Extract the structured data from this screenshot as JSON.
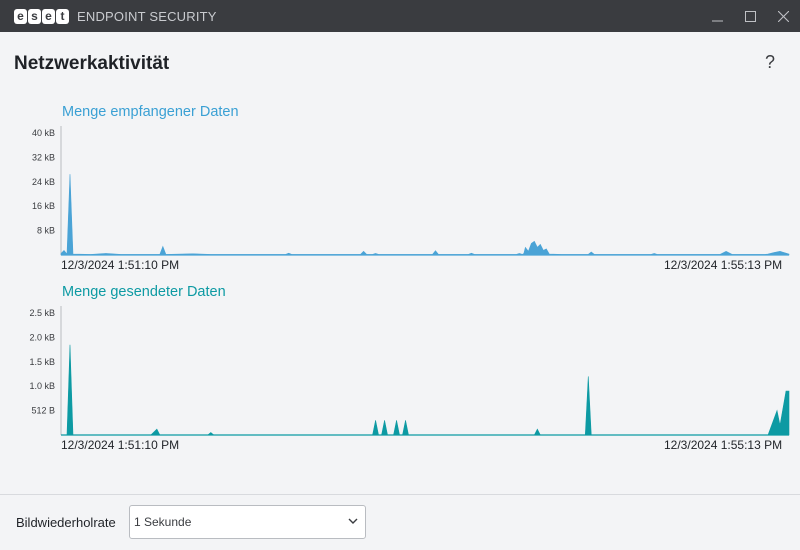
{
  "window": {
    "brand": [
      "e",
      "s",
      "e",
      "t"
    ],
    "product": "ENDPOINT SECURITY",
    "controls": [
      "minimize-icon",
      "maximize-icon",
      "close-icon"
    ]
  },
  "page": {
    "title": "Netzwerkaktivität",
    "help_label": "?"
  },
  "charts": {
    "received": {
      "title": "Menge empfangener Daten",
      "start_time": "12/3/2024 1:51:10 PM",
      "end_time": "12/3/2024 1:55:13 PM"
    },
    "sent": {
      "title": "Menge gesendeter Daten",
      "start_time": "12/3/2024 1:51:10 PM",
      "end_time": "12/3/2024 1:55:13 PM"
    }
  },
  "footer": {
    "refresh_label": "Bildwiederholrate",
    "refresh_value": "1 Sekunde"
  },
  "colors": {
    "received": "#4aa3d6",
    "sent": "#0d9aa3",
    "titlebar": "#3a3c40"
  },
  "chart_data": [
    {
      "type": "area",
      "title": "Menge empfangener Daten",
      "y_unit": "kB",
      "ylim": [
        0,
        40
      ],
      "yticks": [
        {
          "value": 8,
          "label": "8 kB"
        },
        {
          "value": 16,
          "label": "16 kB"
        },
        {
          "value": 24,
          "label": "24 kB"
        },
        {
          "value": 32,
          "label": "32 kB"
        },
        {
          "value": 40,
          "label": "40 kB"
        }
      ],
      "x_range_seconds": [
        0,
        243
      ],
      "x_labels": [
        "12/3/2024 1:51:10 PM",
        "12/3/2024 1:55:13 PM"
      ],
      "series": [
        {
          "color": "#4aa3d6",
          "points": [
            [
              0,
              0.5
            ],
            [
              1,
              1.5
            ],
            [
              2,
              0.3
            ],
            [
              3,
              26.5
            ],
            [
              4,
              0.3
            ],
            [
              10,
              0.2
            ],
            [
              15,
              0.5
            ],
            [
              20,
              0.2
            ],
            [
              33,
              0.2
            ],
            [
              34,
              2.8
            ],
            [
              35,
              0.2
            ],
            [
              44,
              0.4
            ],
            [
              50,
              0.2
            ],
            [
              75,
              0.2
            ],
            [
              76,
              0.6
            ],
            [
              77,
              0.2
            ],
            [
              100,
              0.2
            ],
            [
              101,
              1.2
            ],
            [
              102,
              0.2
            ],
            [
              104,
              0.2
            ],
            [
              105,
              0.5
            ],
            [
              106,
              0.2
            ],
            [
              124,
              0.2
            ],
            [
              125,
              1.4
            ],
            [
              126,
              0.2
            ],
            [
              136,
              0.2
            ],
            [
              137,
              0.6
            ],
            [
              138,
              0.2
            ],
            [
              152,
              0.2
            ],
            [
              153,
              0.5
            ],
            [
              154,
              0.2
            ],
            [
              154.5,
              0.5
            ],
            [
              155,
              2.5
            ],
            [
              156,
              1.2
            ],
            [
              157,
              3.8
            ],
            [
              158,
              4.5
            ],
            [
              159,
              2.5
            ],
            [
              160,
              3.5
            ],
            [
              161,
              1.5
            ],
            [
              162,
              2
            ],
            [
              163,
              0.3
            ],
            [
              167,
              0.2
            ],
            [
              176,
              0.2
            ],
            [
              177,
              1
            ],
            [
              178,
              0.2
            ],
            [
              197,
              0.2
            ],
            [
              198,
              0.5
            ],
            [
              199,
              0.2
            ],
            [
              220,
              0.2
            ],
            [
              222,
              1.2
            ],
            [
              224,
              0.2
            ],
            [
              235,
              0.2
            ],
            [
              236,
              0.3
            ],
            [
              238,
              0.8
            ],
            [
              240,
              1.2
            ],
            [
              241,
              0.9
            ],
            [
              242,
              0.6
            ],
            [
              243,
              0.3
            ]
          ]
        }
      ]
    },
    {
      "type": "area",
      "title": "Menge gesendeter Daten",
      "y_unit": "B",
      "ylim": [
        0,
        2.5
      ],
      "yticks": [
        {
          "value": 0.5,
          "label": "512 B"
        },
        {
          "value": 1.0,
          "label": "1.0 kB"
        },
        {
          "value": 1.5,
          "label": "1.5 kB"
        },
        {
          "value": 2.0,
          "label": "2.0 kB"
        },
        {
          "value": 2.5,
          "label": "2.5 kB"
        }
      ],
      "x_range_seconds": [
        0,
        243
      ],
      "x_labels": [
        "12/3/2024 1:51:10 PM",
        "12/3/2024 1:55:13 PM"
      ],
      "series": [
        {
          "color": "#0d9aa3",
          "points": [
            [
              0,
              0
            ],
            [
              2,
              0
            ],
            [
              3,
              1.85
            ],
            [
              4,
              0
            ],
            [
              30,
              0
            ],
            [
              32,
              0.12
            ],
            [
              33,
              0
            ],
            [
              49,
              0
            ],
            [
              50,
              0.05
            ],
            [
              51,
              0
            ],
            [
              104,
              0
            ],
            [
              105,
              0.3
            ],
            [
              106,
              0
            ],
            [
              107,
              0
            ],
            [
              108,
              0.3
            ],
            [
              109,
              0
            ],
            [
              111,
              0
            ],
            [
              112,
              0.3
            ],
            [
              113,
              0
            ],
            [
              114,
              0
            ],
            [
              115,
              0.3
            ],
            [
              116,
              0
            ],
            [
              158,
              0
            ],
            [
              159,
              0.12
            ],
            [
              160,
              0
            ],
            [
              175,
              0
            ],
            [
              176,
              1.2
            ],
            [
              177,
              0
            ],
            [
              236,
              0
            ],
            [
              239,
              0.5
            ],
            [
              240,
              0.2
            ],
            [
              242,
              0.9
            ],
            [
              243,
              0.9
            ]
          ]
        }
      ]
    }
  ]
}
